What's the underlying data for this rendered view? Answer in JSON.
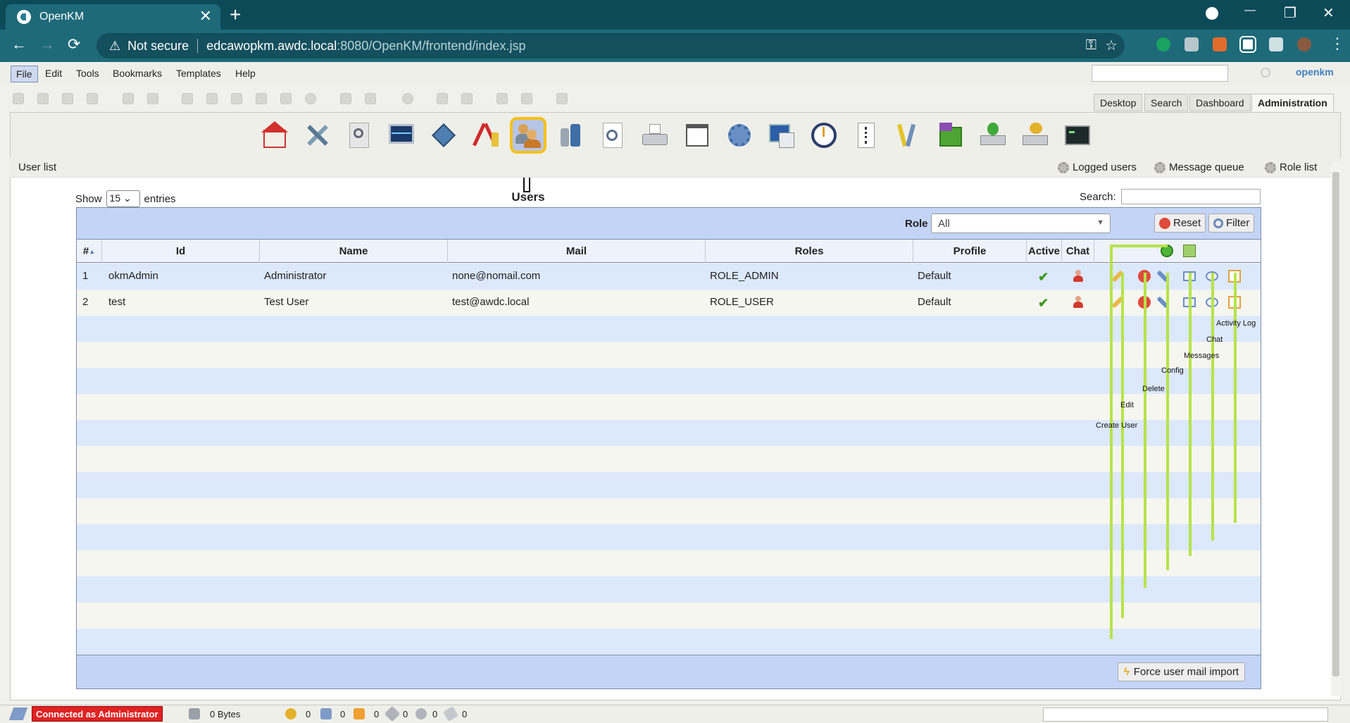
{
  "browser": {
    "tab_title": "OpenKM",
    "close_glyph": "✕",
    "newtab_glyph": "+",
    "warning_glyph": "⚠",
    "security_text": "Not secure",
    "host": "edcawopkm.awdc.local",
    "path": ":8080/OpenKM/frontend/index.jsp",
    "back_glyph": "←",
    "forward_glyph": "→",
    "reload_glyph": "⟳",
    "minimize_glyph": "—",
    "restore_glyph": "❐",
    "window_close_glyph": "✕",
    "star_glyph": "☆",
    "key_glyph": "⚿",
    "menu_glyph": "⋮"
  },
  "menubar": {
    "items": [
      "File",
      "Edit",
      "Tools",
      "Bookmarks",
      "Templates",
      "Help"
    ],
    "brand": "openkm"
  },
  "workspace_tabs": [
    "Desktop",
    "Search",
    "Dashboard",
    "Administration"
  ],
  "admin_icons": [
    "home-icon",
    "tools-icon",
    "search-doc-icon",
    "monitor-icon",
    "diamond-icon",
    "scissors-icon",
    "users-icon",
    "database-icon",
    "magnifier-icon",
    "scanner-icon",
    "calendar-icon",
    "settings-icon",
    "report-icon",
    "clock-icon",
    "list-icon",
    "pen-icon",
    "box-icon",
    "import-icon",
    "export-icon",
    "terminal-icon"
  ],
  "annotation": {
    "users": "Users"
  },
  "breadcrumb": "User list",
  "subtabs": [
    "Logged users",
    "Message queue",
    "Role list"
  ],
  "table": {
    "show_label": "Show",
    "page_size": "15",
    "entries_label": "entries",
    "search_label": "Search:",
    "role_label": "Role",
    "role_value": "All",
    "reset_label": "Reset",
    "filter_label": "Filter",
    "columns": {
      "num": "#",
      "id": "Id",
      "name": "Name",
      "mail": "Mail",
      "roles": "Roles",
      "profile": "Profile",
      "active": "Active",
      "chat": "Chat"
    },
    "rows": [
      {
        "num": "1",
        "id": "okmAdmin",
        "name": "Administrator",
        "mail": "none@nomail.com",
        "roles": "ROLE_ADMIN",
        "profile": "Default"
      },
      {
        "num": "2",
        "id": "test",
        "name": "Test User",
        "mail": "test@awdc.local",
        "roles": "ROLE_USER",
        "profile": "Default"
      }
    ],
    "force_label": "Force user mail import",
    "check_glyph": "✔"
  },
  "callouts": {
    "create": "Create User",
    "edit": "Edit",
    "delete": "Delete",
    "config": "Config",
    "messages": "Messages",
    "chat": "Chat",
    "activity": "Activity Log"
  },
  "status": {
    "connected": "Connected as Administrator",
    "size": "0 Bytes",
    "counts": [
      "0",
      "0",
      "0",
      "0",
      "0",
      "0"
    ]
  },
  "colors": {
    "chrome": "#0d4a58",
    "header": "#c3d4f6",
    "row_alt": "#dce8fc",
    "highlight": "#f4c21a",
    "callout_line": "#b6e34a",
    "status_red": "#e02222"
  }
}
